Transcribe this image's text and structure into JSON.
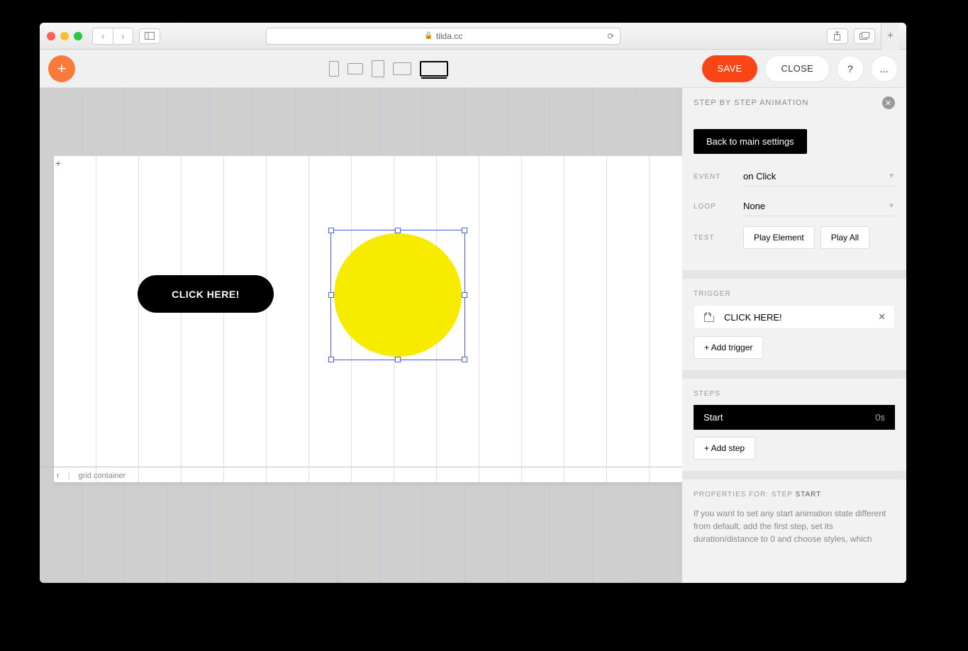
{
  "browser": {
    "url": "tilda.cc"
  },
  "toolbar": {
    "save": "SAVE",
    "close": "CLOSE",
    "help": "?",
    "more": "..."
  },
  "canvas": {
    "button_label": "CLICK HERE!",
    "status_left": "r",
    "status_item": "grid container"
  },
  "panel": {
    "title": "STEP BY STEP ANIMATION",
    "back": "Back to main settings",
    "event_label": "EVENT",
    "event_value": "on Click",
    "loop_label": "LOOP",
    "loop_value": "None",
    "test_label": "TEST",
    "play_element": "Play Element",
    "play_all": "Play All",
    "trigger_label": "TRIGGER",
    "trigger_value": "CLICK HERE!",
    "add_trigger": "+ Add trigger",
    "steps_label": "STEPS",
    "step_name": "Start",
    "step_time": "0s",
    "add_step": "+ Add step",
    "props_prefix": "PROPERTIES FOR: STEP ",
    "props_step": "START",
    "help": "If you want to set any start animation state different from default, add the first step, set its duration/distance to 0 and choose styles, which"
  }
}
